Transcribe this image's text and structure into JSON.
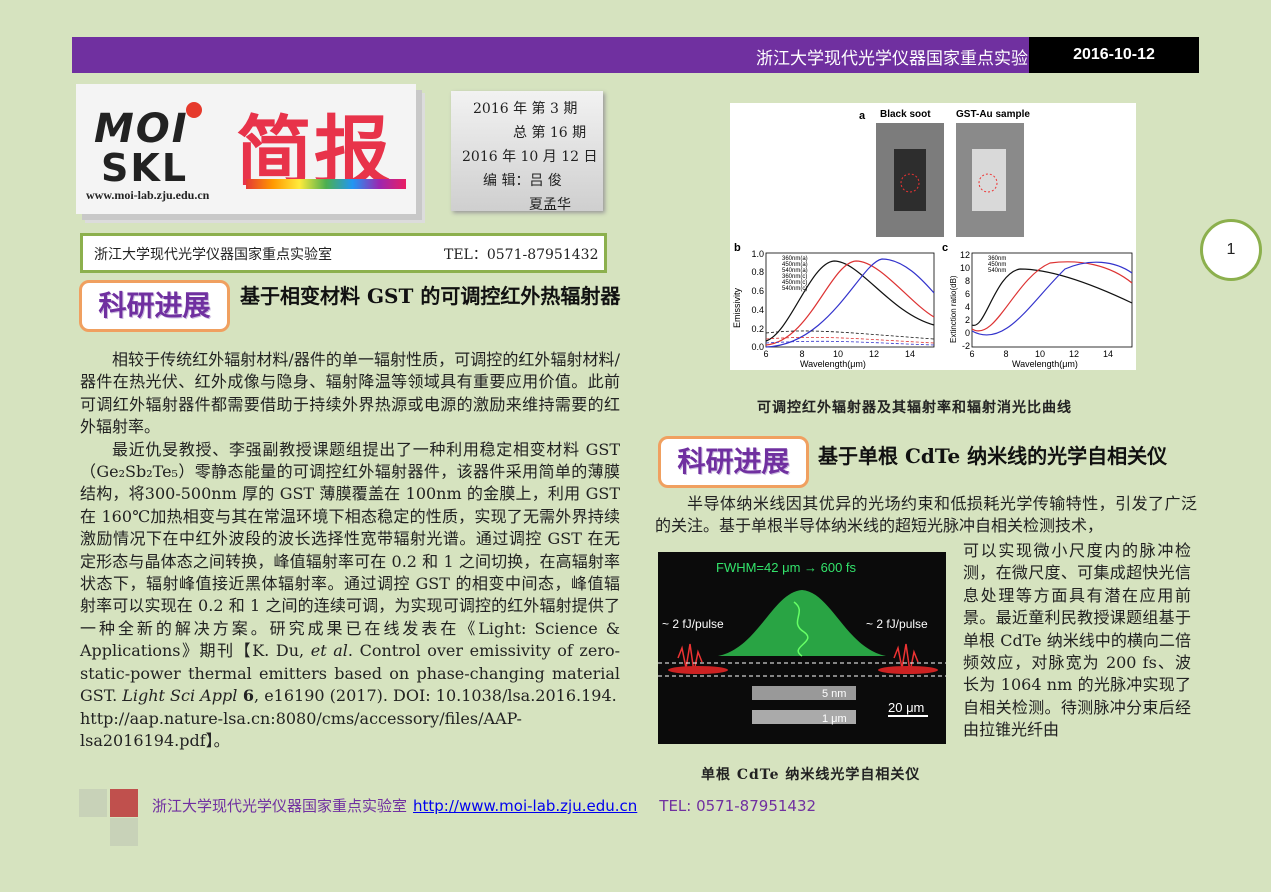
{
  "header": {
    "title": "浙江大学现代光学仪器国家重点实验室简报",
    "date": "2016-10-12"
  },
  "logo": {
    "moi": "MOI",
    "skl": "SKL",
    "jianbao": "简报",
    "url": "www.moi-lab.zju.edu.cn"
  },
  "issue": {
    "line1": "2016 年 第 3  期",
    "line2": "总 第 16 期",
    "line3": "2016 年 10 月 12 日",
    "line4": "编  辑：吕   俊",
    "line5": "夏孟华"
  },
  "labbox": {
    "name": "浙江大学现代光学仪器国家重点实验室",
    "tel": "TEL：0571-87951432"
  },
  "page_number": "1",
  "article1": {
    "tag": "科研进展",
    "title": "基于相变材料 GST 的可调控红外热辐射器",
    "p1": "相较于传统红外辐射材料/器件的单一辐射性质，可调控的红外辐射材料/器件在热光伏、红外成像与隐身、辐射降温等领域具有重要应用价值。此前可调红外辐射器件都需要借助于持续外界热源或电源的激励来维持需要的红外辐射率。",
    "p2_a": "最近仇旻教授、李强副教授课题组提出了一种利用稳定相变材料 GST（Ge₂Sb₂Te₅）零静态能量的可调控红外辐射器件，该器件采用简单的薄膜结构，将300-500nm 厚的 GST 薄膜覆盖在 100nm 的金膜上，利用 GST 在 160℃加热相变与其在常温环境下相态稳定的性质，实现了无需外界持续激励情况下在中红外波段的波长选择性宽带辐射光谱。通过调控 GST 在无定形态与晶体态之间转换，峰值辐射率可在 0.2 和 1 之间切换，在高辐射率状态下，辐射峰值接近黑体辐射率。通过调控 GST 的相变中间态，峰值辐射率可以实现在 0.2 和 1 之间的连续可调，为实现可调控的红外辐射提供了一种全新的解决方案。研究成果已在线发表在《Light: Science & Applications》期刊【K. Du, ",
    "p2_et": "et al",
    "p2_b": ". Control over emissivity of zero-static-power thermal emitters based on phase-changing material GST. ",
    "p2_journal": "Light Sci Appl",
    "p2_vol": " 6",
    "p2_c": ", e16190 (2017). DOI: 10.1038/lsa.2016.194.",
    "p2_url": "http://aap.nature-lsa.cn:8080/cms/accessory/files/AAP-lsa2016194.pdf】。"
  },
  "figure1": {
    "panel_a": "a",
    "label_black": "Black soot",
    "label_gst": "GST-Au sample",
    "panel_b": "b",
    "panel_c": "c",
    "xlabel": "Wavelength(μm)",
    "ylabel_b": "Emissivity",
    "ylabel_c": "Extinction ratio(dB)",
    "b_yticks": [
      "1.0",
      "0.8",
      "0.6",
      "0.4",
      "0.2",
      "0.0"
    ],
    "c_yticks": [
      "12",
      "10",
      "8",
      "6",
      "4",
      "2",
      "0",
      "-2"
    ],
    "xticks": [
      "6",
      "8",
      "10",
      "12",
      "14"
    ],
    "legend_b": [
      "360nm(a)",
      "450nm(a)",
      "540nm(a)",
      "360nm(c)",
      "450nm(c)",
      "540nm(c)"
    ],
    "legend_c": [
      "360nm",
      "450nm",
      "540nm"
    ],
    "caption": "可调控红外辐射器及其辐射率和辐射消光比曲线"
  },
  "article2": {
    "tag": "科研进展",
    "title": "基于单根 CdTe 纳米线的光学自相关仪",
    "p_full": "半导体纳米线因其优异的光场约束和低损耗光学传输特性，引发了广泛的关注。基于单根半导体纳米线的超短光脉冲自相关检测技术，",
    "p_side": "可以实现微小尺度内的脉冲检测，在微尺度、可集成超快光信息处理等方面具有潜在应用前景。最近童利民教授课题组基于单根 CdTe 纳米线中的横向二倍频效应，对脉宽为 200 fs、波长为 1064 nm 的光脉冲实现了自相关检测。待测脉冲分束后经由拉锥光纤由"
  },
  "figure2": {
    "fwhm": "FWHM=42 μm → 600 fs",
    "pulse_left": "~ 2 fJ/pulse",
    "pulse_right": "~ 2 fJ/pulse",
    "scale1": "5 nm",
    "scale2": "1 μm",
    "scale3": "20 μm",
    "caption": "单根 CdTe 纳米线光学自相关仪"
  },
  "footer": {
    "lab": "浙江大学现代光学仪器国家重点实验室",
    "url": "http://www.moi-lab.zju.edu.cn",
    "tel": "TEL: 0571-87951432"
  },
  "colors": {
    "page_bg": "#d6e3bf",
    "header_purple": "#7030a0",
    "accent_green": "#8cb04d",
    "tag_orange": "#f0a060",
    "footer_red": "#c0504d"
  }
}
